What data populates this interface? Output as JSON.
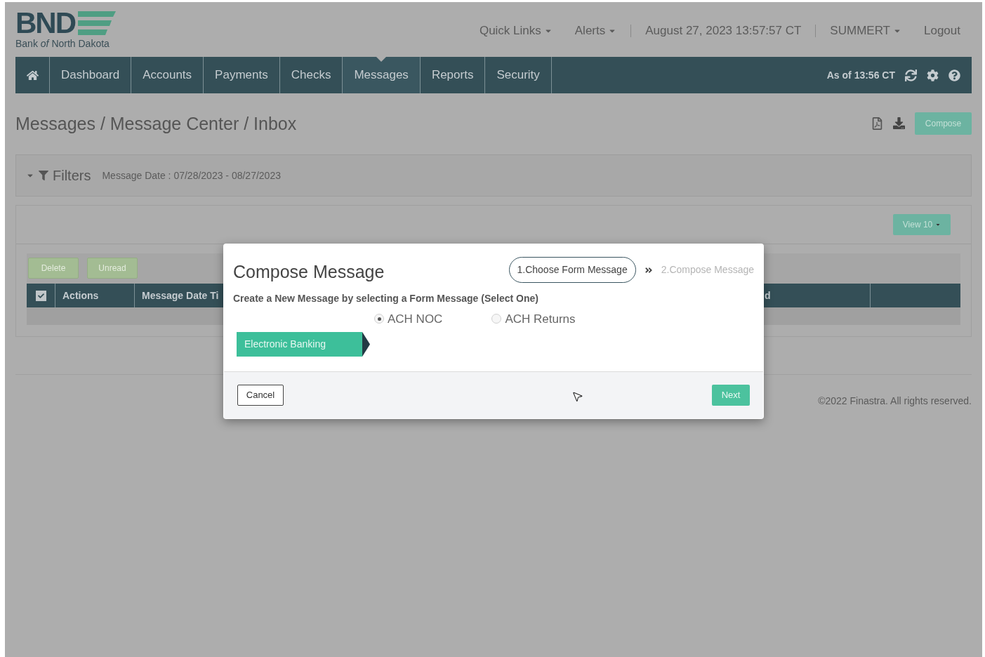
{
  "header": {
    "wordmark": "BND",
    "tagline": "Bank *of* North Dakota"
  },
  "top_links": [
    {
      "label": "Quick Links",
      "kind": "dropdown"
    },
    {
      "label": "Alerts",
      "kind": "dropdown"
    },
    {
      "label": "August 27, 2023 13:57:57 CT",
      "kind": "text"
    },
    {
      "label": "SUMMERT",
      "kind": "dropdown"
    },
    {
      "label": "Logout",
      "kind": "link"
    }
  ],
  "nav": {
    "items": [
      {
        "kind": "home",
        "selected": false
      },
      {
        "kind": "link",
        "label": "Dashboard",
        "selected": false
      },
      {
        "kind": "link",
        "label": "Accounts",
        "selected": false
      },
      {
        "kind": "link",
        "label": "Payments",
        "selected": false
      },
      {
        "kind": "link",
        "label": "Checks",
        "selected": false
      },
      {
        "kind": "link",
        "label": "Messages",
        "selected": true
      },
      {
        "kind": "link",
        "label": "Reports",
        "selected": false
      },
      {
        "kind": "link",
        "label": "Security",
        "selected": false
      }
    ],
    "status": "As of 13:56 CT"
  },
  "page": {
    "breadcrumb": "Messages / Message Center / Inbox",
    "compose_button": "Compose"
  },
  "filters": {
    "expanded": true,
    "title": "Filters",
    "summary": "Message Date : 07/28/2023 - 08/27/2023"
  },
  "view_button": "View 10",
  "bulk_actions": [
    {
      "label": "Delete",
      "disabled": true
    },
    {
      "label": "Unread",
      "disabled": true
    }
  ],
  "table": {
    "select_all_checked": true,
    "columns": [
      "Actions",
      "Message Date Ti",
      "d"
    ]
  },
  "footer": {
    "copyright": "©2022 Finastra. All rights reserved."
  },
  "modal": {
    "title": "Compose Message",
    "steps": [
      {
        "label": "1.Choose Form Message",
        "selected": true
      },
      {
        "label": "2.Compose Message",
        "selected": false
      }
    ],
    "instruction": "Create a New Message by selecting a Form Message (Select One)",
    "categories": [
      {
        "label": "Electronic Banking",
        "selected": true
      }
    ],
    "options": [
      {
        "label": "ACH NOC",
        "selected": true
      },
      {
        "label": "ACH Returns",
        "selected": false
      }
    ],
    "cancel": "Cancel",
    "next": "Next"
  }
}
